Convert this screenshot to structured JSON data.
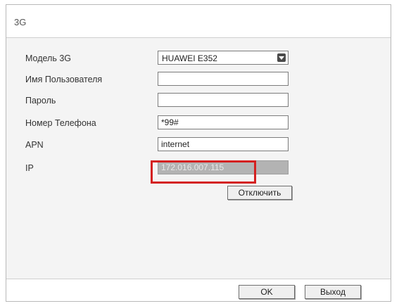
{
  "dialog": {
    "title": "3G"
  },
  "form": {
    "model": {
      "label": "Модель 3G",
      "value": "HUAWEI E352"
    },
    "username": {
      "label": "Имя Пользователя",
      "value": ""
    },
    "password": {
      "label": "Пароль",
      "value": ""
    },
    "phone": {
      "label": "Номер Телефона",
      "value": "*99#"
    },
    "apn": {
      "label": "APN",
      "value": "internet"
    },
    "ip": {
      "label": "IP",
      "value": "172.016.007.115"
    }
  },
  "buttons": {
    "disconnect": "Отключить",
    "ok": "OK",
    "exit": "Выход"
  },
  "colors": {
    "highlight": "#d42020",
    "readonly_field": "#b3b3b3"
  }
}
